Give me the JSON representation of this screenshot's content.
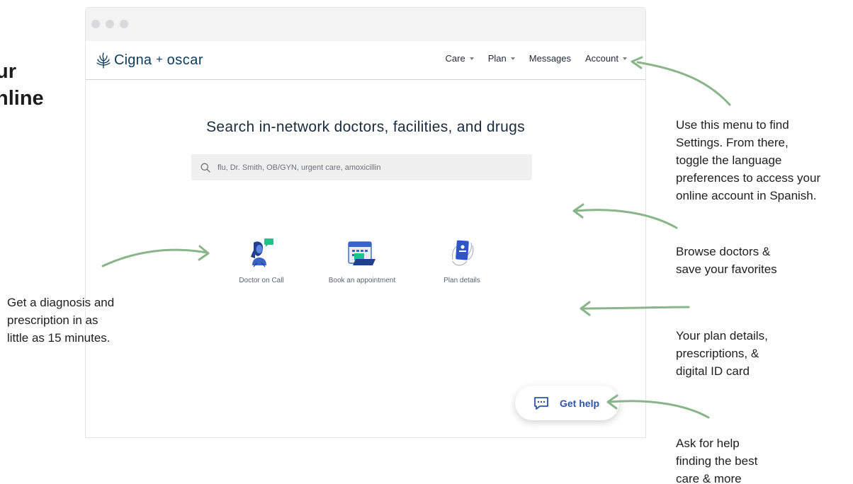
{
  "left_heading": {
    "line1": "ur",
    "line2": "nline"
  },
  "app": {
    "logo": {
      "cigna": "Cigna",
      "plus": "+",
      "oscar": "oscar"
    },
    "nav": [
      {
        "label": "Care"
      },
      {
        "label": "Plan"
      },
      {
        "label": "Messages"
      },
      {
        "label": "Account"
      }
    ],
    "search": {
      "title": "Search in-network doctors, facilities, and drugs",
      "placeholder": "flu, Dr. Smith, OB/GYN, urgent care, amoxicillin",
      "value": ""
    },
    "tiles": [
      {
        "label": "Doctor on Call",
        "icon": "doctor-chat-icon"
      },
      {
        "label": "Book an appointment",
        "icon": "calendar-icon"
      },
      {
        "label": "Plan details",
        "icon": "id-card-icon"
      }
    ],
    "get_help": {
      "label": "Get help",
      "icon": "chat-bubble-icon"
    }
  },
  "annotations": {
    "menu": [
      "Use this menu to find",
      "Settings. From there,",
      "toggle the language",
      "preferences to access your",
      "online account in Spanish."
    ],
    "browse": [
      "Browse doctors &",
      "save your favorites"
    ],
    "plan": [
      "Your plan details,",
      "prescriptions, &",
      "digital ID card"
    ],
    "help": [
      "Ask for help",
      "finding the best",
      "care & more"
    ],
    "diagnosis": [
      "Get a diagnosis and",
      "prescription in as",
      "little as 15 minutes."
    ]
  },
  "colors": {
    "arrow": "#8ab48a",
    "brand": "#0b3a5b",
    "help": "#2f54a3"
  }
}
